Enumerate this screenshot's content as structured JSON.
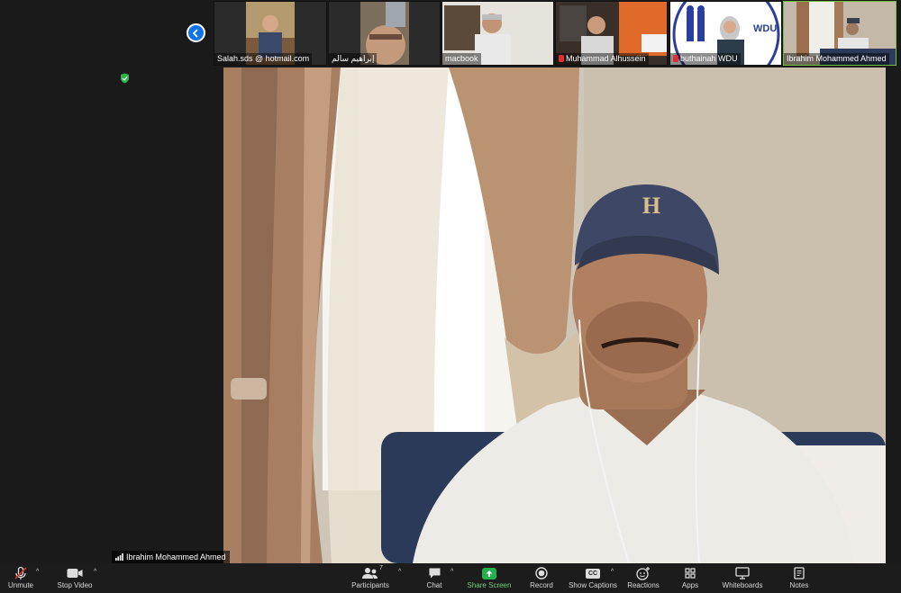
{
  "participants": [
    {
      "name": "Salah.sds @ hotmail.com",
      "muted": false,
      "active": false
    },
    {
      "name": "إبراهيم سالم",
      "muted": false,
      "active": false
    },
    {
      "name": "macbook",
      "muted": false,
      "active": false
    },
    {
      "name": "Muhammad Alhussein",
      "muted": true,
      "active": false
    },
    {
      "name": "buthainah WDU",
      "muted": true,
      "active": false
    },
    {
      "name": "Ibrahim Mohammed Ahmed",
      "muted": false,
      "active": true
    }
  ],
  "logo_text": "WDU",
  "speaker": {
    "name": "Ibrahim Mohammed Ahmed",
    "cap_letter": "H"
  },
  "toolbar": {
    "unmute": "Unmute",
    "stop_video": "Stop Video",
    "participants": "Participants",
    "participants_count": "7",
    "chat": "Chat",
    "share_screen": "Share Screen",
    "record": "Record",
    "show_captions": "Show Captions",
    "captions_icon_text": "CC",
    "reactions": "Reactions",
    "apps": "Apps",
    "whiteboards": "Whiteboards",
    "notes": "Notes"
  },
  "colors": {
    "accent": "#0e72ed",
    "share": "#22b14c",
    "muted": "#e0302d",
    "active_border": "#6fbf3a"
  }
}
